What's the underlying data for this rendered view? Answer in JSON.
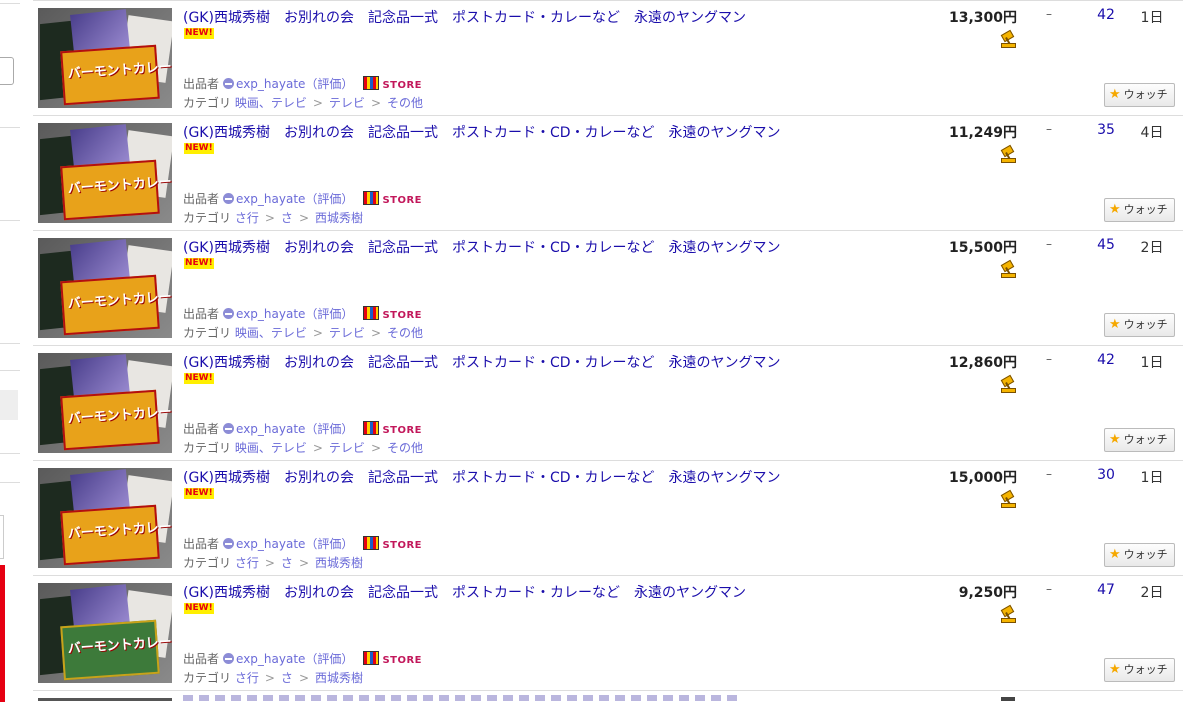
{
  "common": {
    "new_badge": "NEW!",
    "seller_label": "出品者",
    "seller_name": "exp_hayate",
    "rating_label": "（評価）",
    "store_label": "STORE",
    "category_label": "カテゴリ",
    "separator": ">",
    "dash": "–",
    "watch_label": "ウォッチ"
  },
  "listings": [
    {
      "title": "(GK)西城秀樹　お別れの会　記念品一式　ポストカード・カレーなど　永遠のヤングマン",
      "price": "13,300円",
      "bids": "42",
      "remaining": "1日",
      "category": [
        "映画、テレビ",
        "テレビ",
        "その他"
      ],
      "box_label": "バーモントカレー",
      "box_style": "yellow"
    },
    {
      "title": "(GK)西城秀樹　お別れの会　記念品一式　ポストカード・CD・カレーなど　永遠のヤングマン",
      "price": "11,249円",
      "bids": "35",
      "remaining": "4日",
      "category": [
        "さ行",
        "さ",
        "西城秀樹"
      ],
      "box_label": "バーモントカレー",
      "box_style": "yellow"
    },
    {
      "title": "(GK)西城秀樹　お別れの会　記念品一式　ポストカード・CD・カレーなど　永遠のヤングマン",
      "price": "15,500円",
      "bids": "45",
      "remaining": "2日",
      "category": [
        "映画、テレビ",
        "テレビ",
        "その他"
      ],
      "box_label": "バーモントカレー",
      "box_style": "yellow"
    },
    {
      "title": "(GK)西城秀樹　お別れの会　記念品一式　ポストカード・CD・カレーなど　永遠のヤングマン",
      "price": "12,860円",
      "bids": "42",
      "remaining": "1日",
      "category": [
        "映画、テレビ",
        "テレビ",
        "その他"
      ],
      "box_label": "バーモントカレー",
      "box_style": "yellow"
    },
    {
      "title": "(GK)西城秀樹　お別れの会　記念品一式　ポストカード・CD・カレーなど　永遠のヤングマン",
      "price": "15,000円",
      "bids": "30",
      "remaining": "1日",
      "category": [
        "さ行",
        "さ",
        "西城秀樹"
      ],
      "box_label": "バーモントカレー",
      "box_style": "yellow"
    },
    {
      "title": "(GK)西城秀樹　お別れの会　記念品一式　ポストカード・カレーなど　永遠のヤングマン",
      "price": "9,250円",
      "bids": "47",
      "remaining": "2日",
      "category": [
        "さ行",
        "さ",
        "西城秀樹"
      ],
      "box_label": "バーモントカレー",
      "box_style": "green"
    }
  ],
  "colors": {
    "link": "#1a0dab",
    "seller_link": "#6a6ad8",
    "accent_red": "#e60012",
    "watch_star": "#f5a800"
  },
  "icons": [
    "seller-icon",
    "store-icon",
    "bid-hammer-icon",
    "star-icon"
  ]
}
